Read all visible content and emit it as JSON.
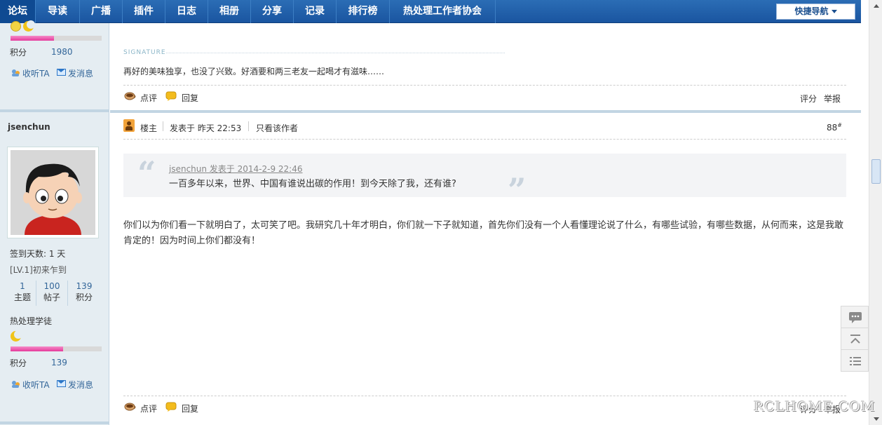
{
  "nav": {
    "items": [
      "论坛",
      "导读",
      "广播",
      "插件",
      "日志",
      "相册",
      "分享",
      "记录",
      "排行榜",
      "热处理工作者协会"
    ],
    "quick_nav": "快捷导航"
  },
  "prev_user": {
    "points_label": "积分",
    "points": "1980",
    "listen_label": "收听TA",
    "message_label": "发消息"
  },
  "user": {
    "name": "jsenchun",
    "checkin_label": "签到天数: 1 天",
    "level": "[LV.1]初来乍到",
    "stats": [
      {
        "value": "1",
        "label": "主题"
      },
      {
        "value": "100",
        "label": "帖子"
      },
      {
        "value": "139",
        "label": "积分"
      }
    ],
    "rank": "热处理学徒",
    "points_label": "积分",
    "points": "139",
    "listen_label": "收听TA",
    "message_label": "发消息"
  },
  "prev_post": {
    "signature_label": "SIGNATURE",
    "signature": "再好的美味独享，也没了兴致。好酒要和两三老友一起喝才有滋味……",
    "comment_label": "点评",
    "reply_label": "回复",
    "rate_label": "评分",
    "report_label": "举报"
  },
  "post": {
    "op_badge": "楼主",
    "posted_at": "发表于 昨天 22:53",
    "author_only": "只看该作者",
    "floor": "88",
    "floor_mark": "#",
    "quote_ref": "jsenchun 发表于 2014-2-9 22:46",
    "quote_text": "一百多年以来，世界、中国有谁说出碳的作用！到今天除了我，还有谁?",
    "body": "你们以为你们看一下就明白了，太可笑了吧。我研究几十年才明白，你们就一下子就知道，首先你们没有一个人看懂理论说了什么，有哪些试验，有哪些数据，从何而来，这是我敢肯定的！因为时间上你们都没有！",
    "comment_label": "点评",
    "reply_label": "回复",
    "rate_label": "评分",
    "report_label": "举报"
  },
  "watermark": "RCLHOME.COM"
}
